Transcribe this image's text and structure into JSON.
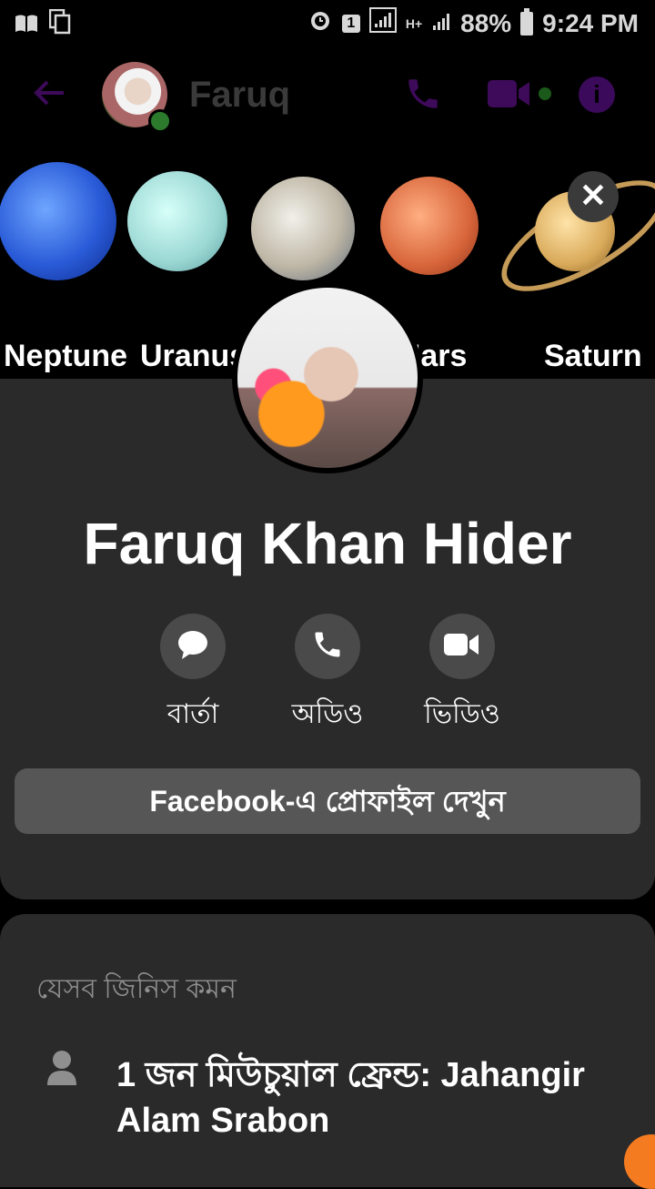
{
  "status_bar": {
    "notification_badge": "1",
    "network": "H+",
    "battery": "88%",
    "time": "9:24 PM"
  },
  "chat_header": {
    "contact_name": "Faruq",
    "accent_color": "#3e0a5a"
  },
  "cover": {
    "labels": [
      "Neptune",
      "Uranus",
      "Mars",
      "Saturn"
    ]
  },
  "profile": {
    "full_name": "Faruq Khan Hider",
    "actions": [
      {
        "label": "বার্তা",
        "icon": "message-icon"
      },
      {
        "label": "অডিও",
        "icon": "phone-icon"
      },
      {
        "label": "ভিডিও",
        "icon": "video-icon"
      }
    ],
    "facebook_button": "Facebook-এ প্রোফাইল দেখুন"
  },
  "common": {
    "title": "যেসব জিনিস কমন",
    "mutual_friends": "1 জন মিউচুয়াল ফ্রেন্ড: Jahangir Alam Srabon"
  }
}
